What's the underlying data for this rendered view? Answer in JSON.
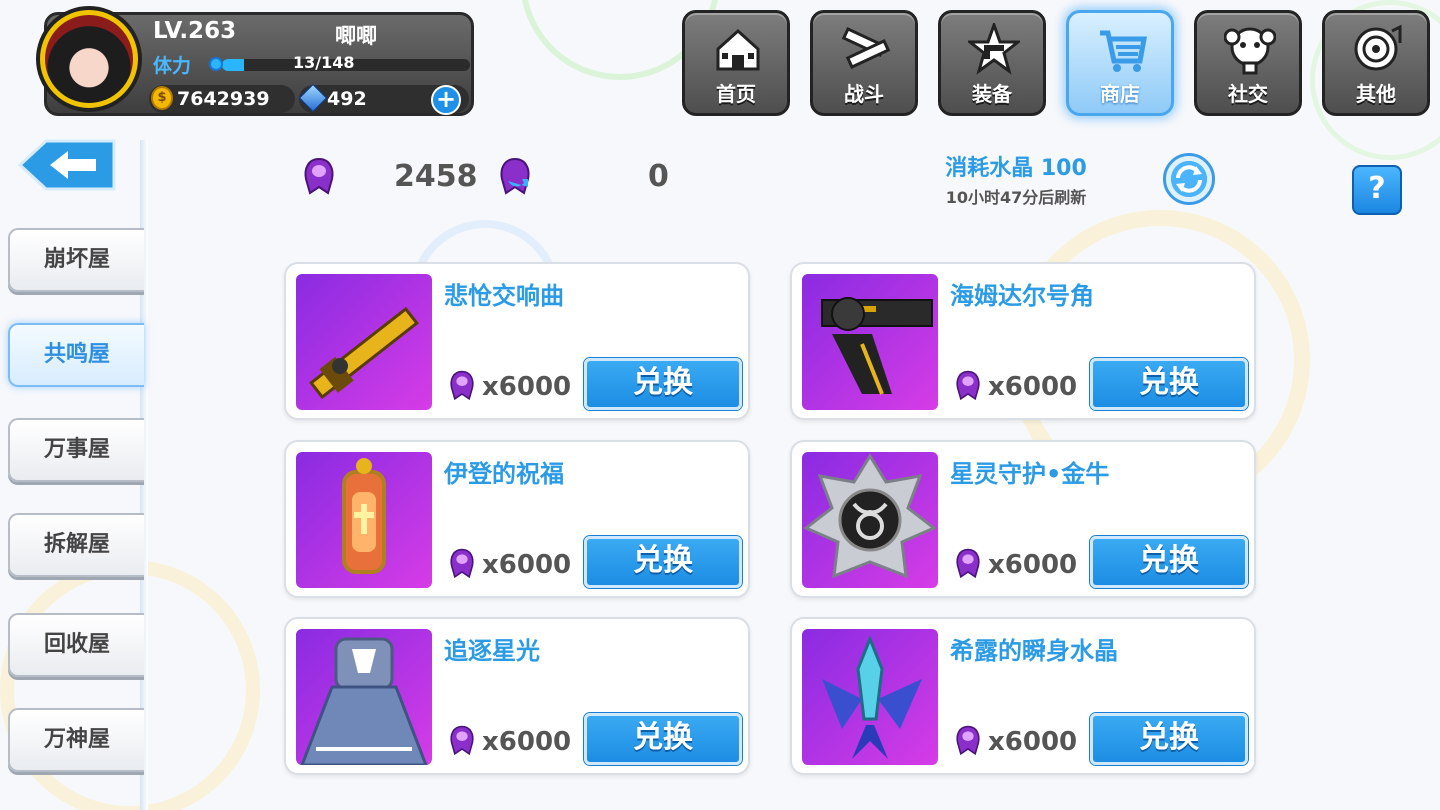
{
  "player": {
    "level": "LV.263",
    "name": "唧唧",
    "stamina_label": "体力",
    "stamina_text": "13/148",
    "stamina_fraction": 0.088,
    "gold": "7642939",
    "gems": "492",
    "add_label": "+"
  },
  "nav": [
    {
      "label": "首页",
      "icon": "house-icon",
      "active": false
    },
    {
      "label": "战斗",
      "icon": "crossed-guns-icon",
      "active": false
    },
    {
      "label": "装备",
      "icon": "star-gun-icon",
      "active": false
    },
    {
      "label": "商店",
      "icon": "shop-basket-icon",
      "active": true
    },
    {
      "label": "社交",
      "icon": "mascot-face-icon",
      "active": false
    },
    {
      "label": "其他",
      "icon": "target-icon",
      "active": false
    }
  ],
  "sidebar": {
    "back_icon": "back-arrow-icon",
    "tabs": [
      {
        "label": "崩坏屋",
        "active": false
      },
      {
        "label": "共鸣屋",
        "active": true
      },
      {
        "label": "万事屋",
        "active": false
      },
      {
        "label": "拆解屋",
        "active": false
      },
      {
        "label": "回收屋",
        "active": false
      },
      {
        "label": "万神屋",
        "active": false
      }
    ]
  },
  "currency": {
    "crystal_count": "2458",
    "swap_crystal_count": "0",
    "cost_label": "消耗水晶 100",
    "refresh_time": "10小时47分后刷新",
    "help_label": "?"
  },
  "items": [
    {
      "name": "悲怆交响曲",
      "price": "x6000",
      "button": "兑换",
      "image": "golden-rifle"
    },
    {
      "name": "海姆达尔号角",
      "price": "x6000",
      "button": "兑换",
      "image": "mounted-cannon"
    },
    {
      "name": "伊登的祝福",
      "price": "x6000",
      "button": "兑换",
      "image": "cross-relic"
    },
    {
      "name": "星灵守护•金牛",
      "price": "x6000",
      "button": "兑换",
      "image": "taurus-badge"
    },
    {
      "name": "追逐星光",
      "price": "x6000",
      "button": "兑换",
      "image": "blue-dress"
    },
    {
      "name": "希露的瞬身水晶",
      "price": "x6000",
      "button": "兑换",
      "image": "crystal-wings"
    }
  ],
  "colors": {
    "accent_blue": "#2b9be5",
    "button_blue": "#1c8de3",
    "item_bg_purple": "#a632e0",
    "nav_dark": "#4e4e4e"
  }
}
